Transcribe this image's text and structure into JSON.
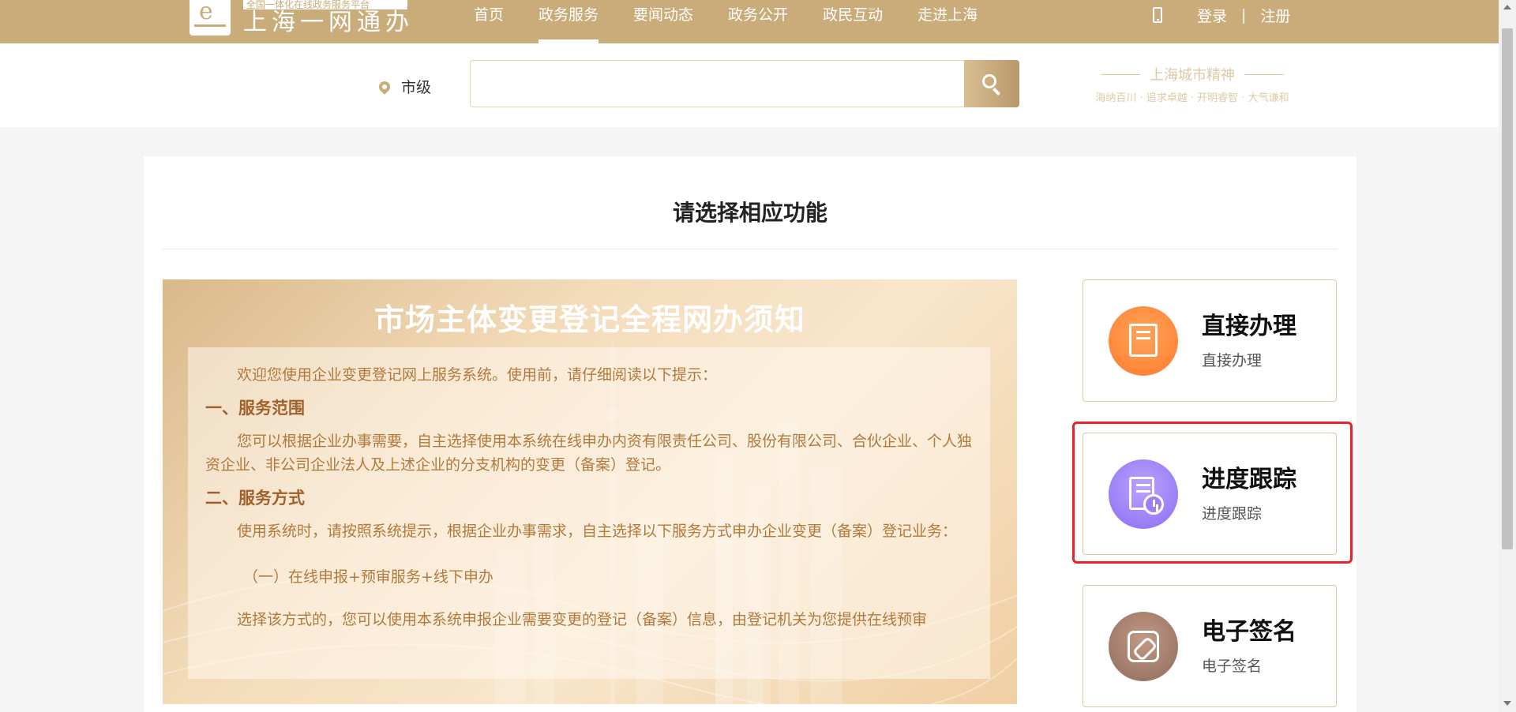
{
  "header": {
    "logo_subtitle": "全国一体化在线政务服务平台",
    "logo_title": "上海一网通办",
    "nav": [
      {
        "label": "首页"
      },
      {
        "label": "政务服务"
      },
      {
        "label": "要闻动态"
      },
      {
        "label": "政务公开"
      },
      {
        "label": "政民互动"
      },
      {
        "label": "走进上海"
      }
    ],
    "active_nav": "政务服务",
    "login": "登录",
    "separator": "|",
    "register": "注册"
  },
  "search": {
    "location": "市级",
    "placeholder": "",
    "value": ""
  },
  "spirit": {
    "title": "上海城市精神",
    "subtitle": "海纳百川 · 追求卓越 · 开明睿智 · 大气谦和"
  },
  "main": {
    "title": "请选择相应功能",
    "notice": {
      "title": "市场主体变更登记全程网办须知",
      "intro": "欢迎您使用企业变更登记网上服务系统。使用前，请仔细阅读以下提示：",
      "section1_heading": "一、服务范围",
      "section1_text": "您可以根据企业办事需要，自主选择使用本系统在线申办内资有限责任公司、股份有限公司、合伙企业、个人独资企业、非公司企业法人及上述企业的分支机构的变更（备案）登记。",
      "section2_heading": "二、服务方式",
      "section2_text": "使用系统时，请按照系统提示，根据企业办事需求，自主选择以下服务方式申办企业变更（备案）登记业务：",
      "item1": "（一）在线申报+预审服务+线下申办",
      "cut_text": "选择该方式的，您可以使用本系统申报企业需要变更的登记（备案）信息，由登记机关为您提供在线预审"
    },
    "functions": [
      {
        "title": "直接办理",
        "subtitle": "直接办理",
        "icon": "document-transfer-icon",
        "color": "#ff8a3d"
      },
      {
        "title": "进度跟踪",
        "subtitle": "进度跟踪",
        "icon": "document-clock-icon",
        "color": "#9b7ff5"
      },
      {
        "title": "电子签名",
        "subtitle": "电子签名",
        "icon": "signature-pen-icon",
        "color": "#a47c6a"
      }
    ],
    "highlight_color": "#e8222a"
  },
  "colors": {
    "brand": "#c9ac79",
    "notice_text": "#b17a3c"
  }
}
